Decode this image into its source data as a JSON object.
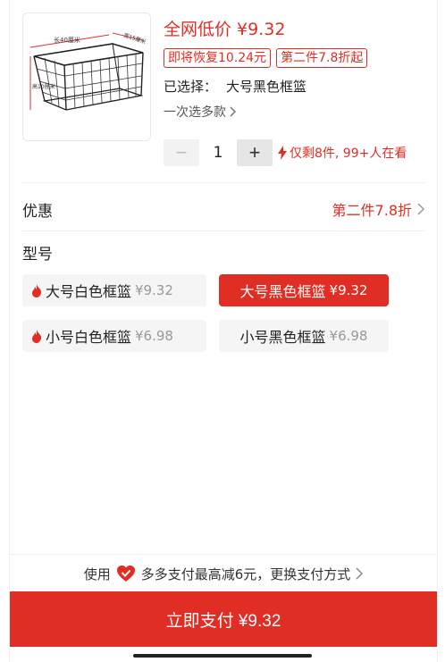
{
  "product": {
    "price_prefix": "全网低价",
    "price": "¥9.32",
    "tags": [
      "即将恢复10.24元",
      "第二件7.8折起"
    ],
    "selected_label": "已选择：",
    "selected_value": "大号黑色框篮",
    "multi_select_label": "一次选多款",
    "image_labels": {
      "length": "长40厘米",
      "width": "宽15厘米",
      "height": "高10厘米"
    }
  },
  "quantity": {
    "minus": "−",
    "value": "1",
    "plus": "+",
    "stock_text": "仅剩8件, 99+人在看"
  },
  "promo": {
    "label": "优惠",
    "value": "第二件7.8折"
  },
  "model": {
    "title": "型号",
    "options": [
      {
        "name": "大号白色框篮",
        "price": "¥9.32",
        "hot": true,
        "selected": false
      },
      {
        "name": "大号黑色框篮",
        "price": "¥9.32",
        "hot": false,
        "selected": true
      },
      {
        "name": "小号白色框篮",
        "price": "¥6.98",
        "hot": true,
        "selected": false
      },
      {
        "name": "小号黑色框篮",
        "price": "¥6.98",
        "hot": false,
        "selected": false
      }
    ]
  },
  "payment": {
    "hint_prefix": "使用",
    "hint_text": "多多支付最高减6元，更换支付方式",
    "button_label": "立即支付 ¥9.32"
  },
  "colors": {
    "accent": "#e02e24"
  }
}
